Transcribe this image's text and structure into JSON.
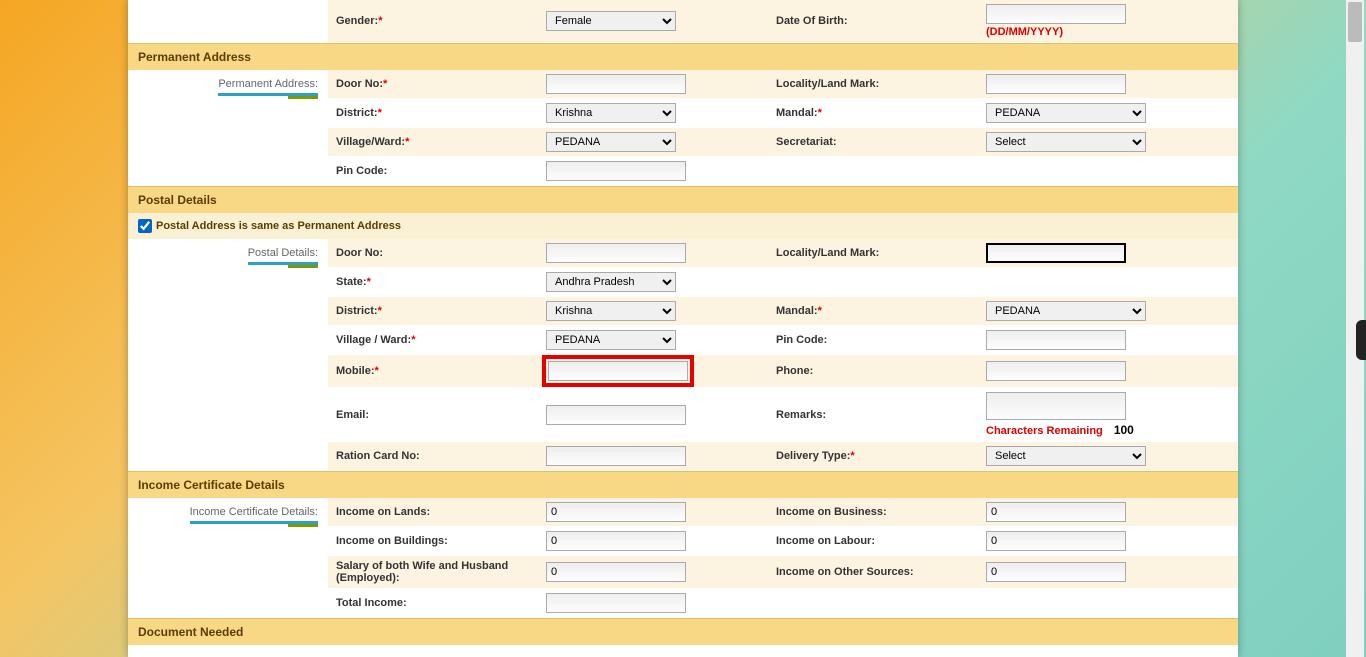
{
  "personal": {
    "gender_label": "Gender:",
    "gender_value": "Female",
    "dob_label": "Date Of Birth:",
    "dob_hint": "(DD/MM/YYYY)"
  },
  "permanent_address": {
    "section_title": "Permanent Address",
    "side_label": "Permanent Address:",
    "door_no_label": "Door No:",
    "locality_label": "Locality/Land Mark:",
    "district_label": "District:",
    "district_value": "Krishna",
    "mandal_label": "Mandal:",
    "mandal_value": "PEDANA",
    "village_label": "Village/Ward:",
    "village_value": "PEDANA",
    "secretariat_label": "Secretariat:",
    "secretariat_value": "Select",
    "pincode_label": "Pin Code:"
  },
  "postal": {
    "section_title": "Postal Details",
    "checkbox_label": "Postal Address is same as Permanent Address",
    "side_label": "Postal Details:",
    "door_no_label": "Door No:",
    "locality_label": "Locality/Land Mark:",
    "state_label": "State:",
    "state_value": "Andhra Pradesh",
    "district_label": "District:",
    "district_value": "Krishna",
    "mandal_label": "Mandal:",
    "mandal_value": "PEDANA",
    "village_label": "Village / Ward:",
    "village_value": "PEDANA",
    "pincode_label": "Pin Code:",
    "mobile_label": "Mobile:",
    "phone_label": "Phone:",
    "email_label": "Email:",
    "remarks_label": "Remarks:",
    "char_remaining_label": "Characters Remaining",
    "char_count": "100",
    "ration_label": "Ration Card No:",
    "delivery_label": "Delivery Type:",
    "delivery_value": "Select"
  },
  "income": {
    "section_title": "Income Certificate Details",
    "side_label": "Income Certificate Details:",
    "lands_label": "Income on Lands:",
    "lands_value": "0",
    "business_label": "Income on Business:",
    "business_value": "0",
    "buildings_label": "Income on Buildings:",
    "buildings_value": "0",
    "labour_label": "Income on Labour:",
    "labour_value": "0",
    "salary_label": "Salary of both Wife and Husband (Employed):",
    "salary_value": "0",
    "other_label": "Income on Other Sources:",
    "other_value": "0",
    "total_label": "Total Income:"
  },
  "document": {
    "section_title": "Document Needed"
  }
}
